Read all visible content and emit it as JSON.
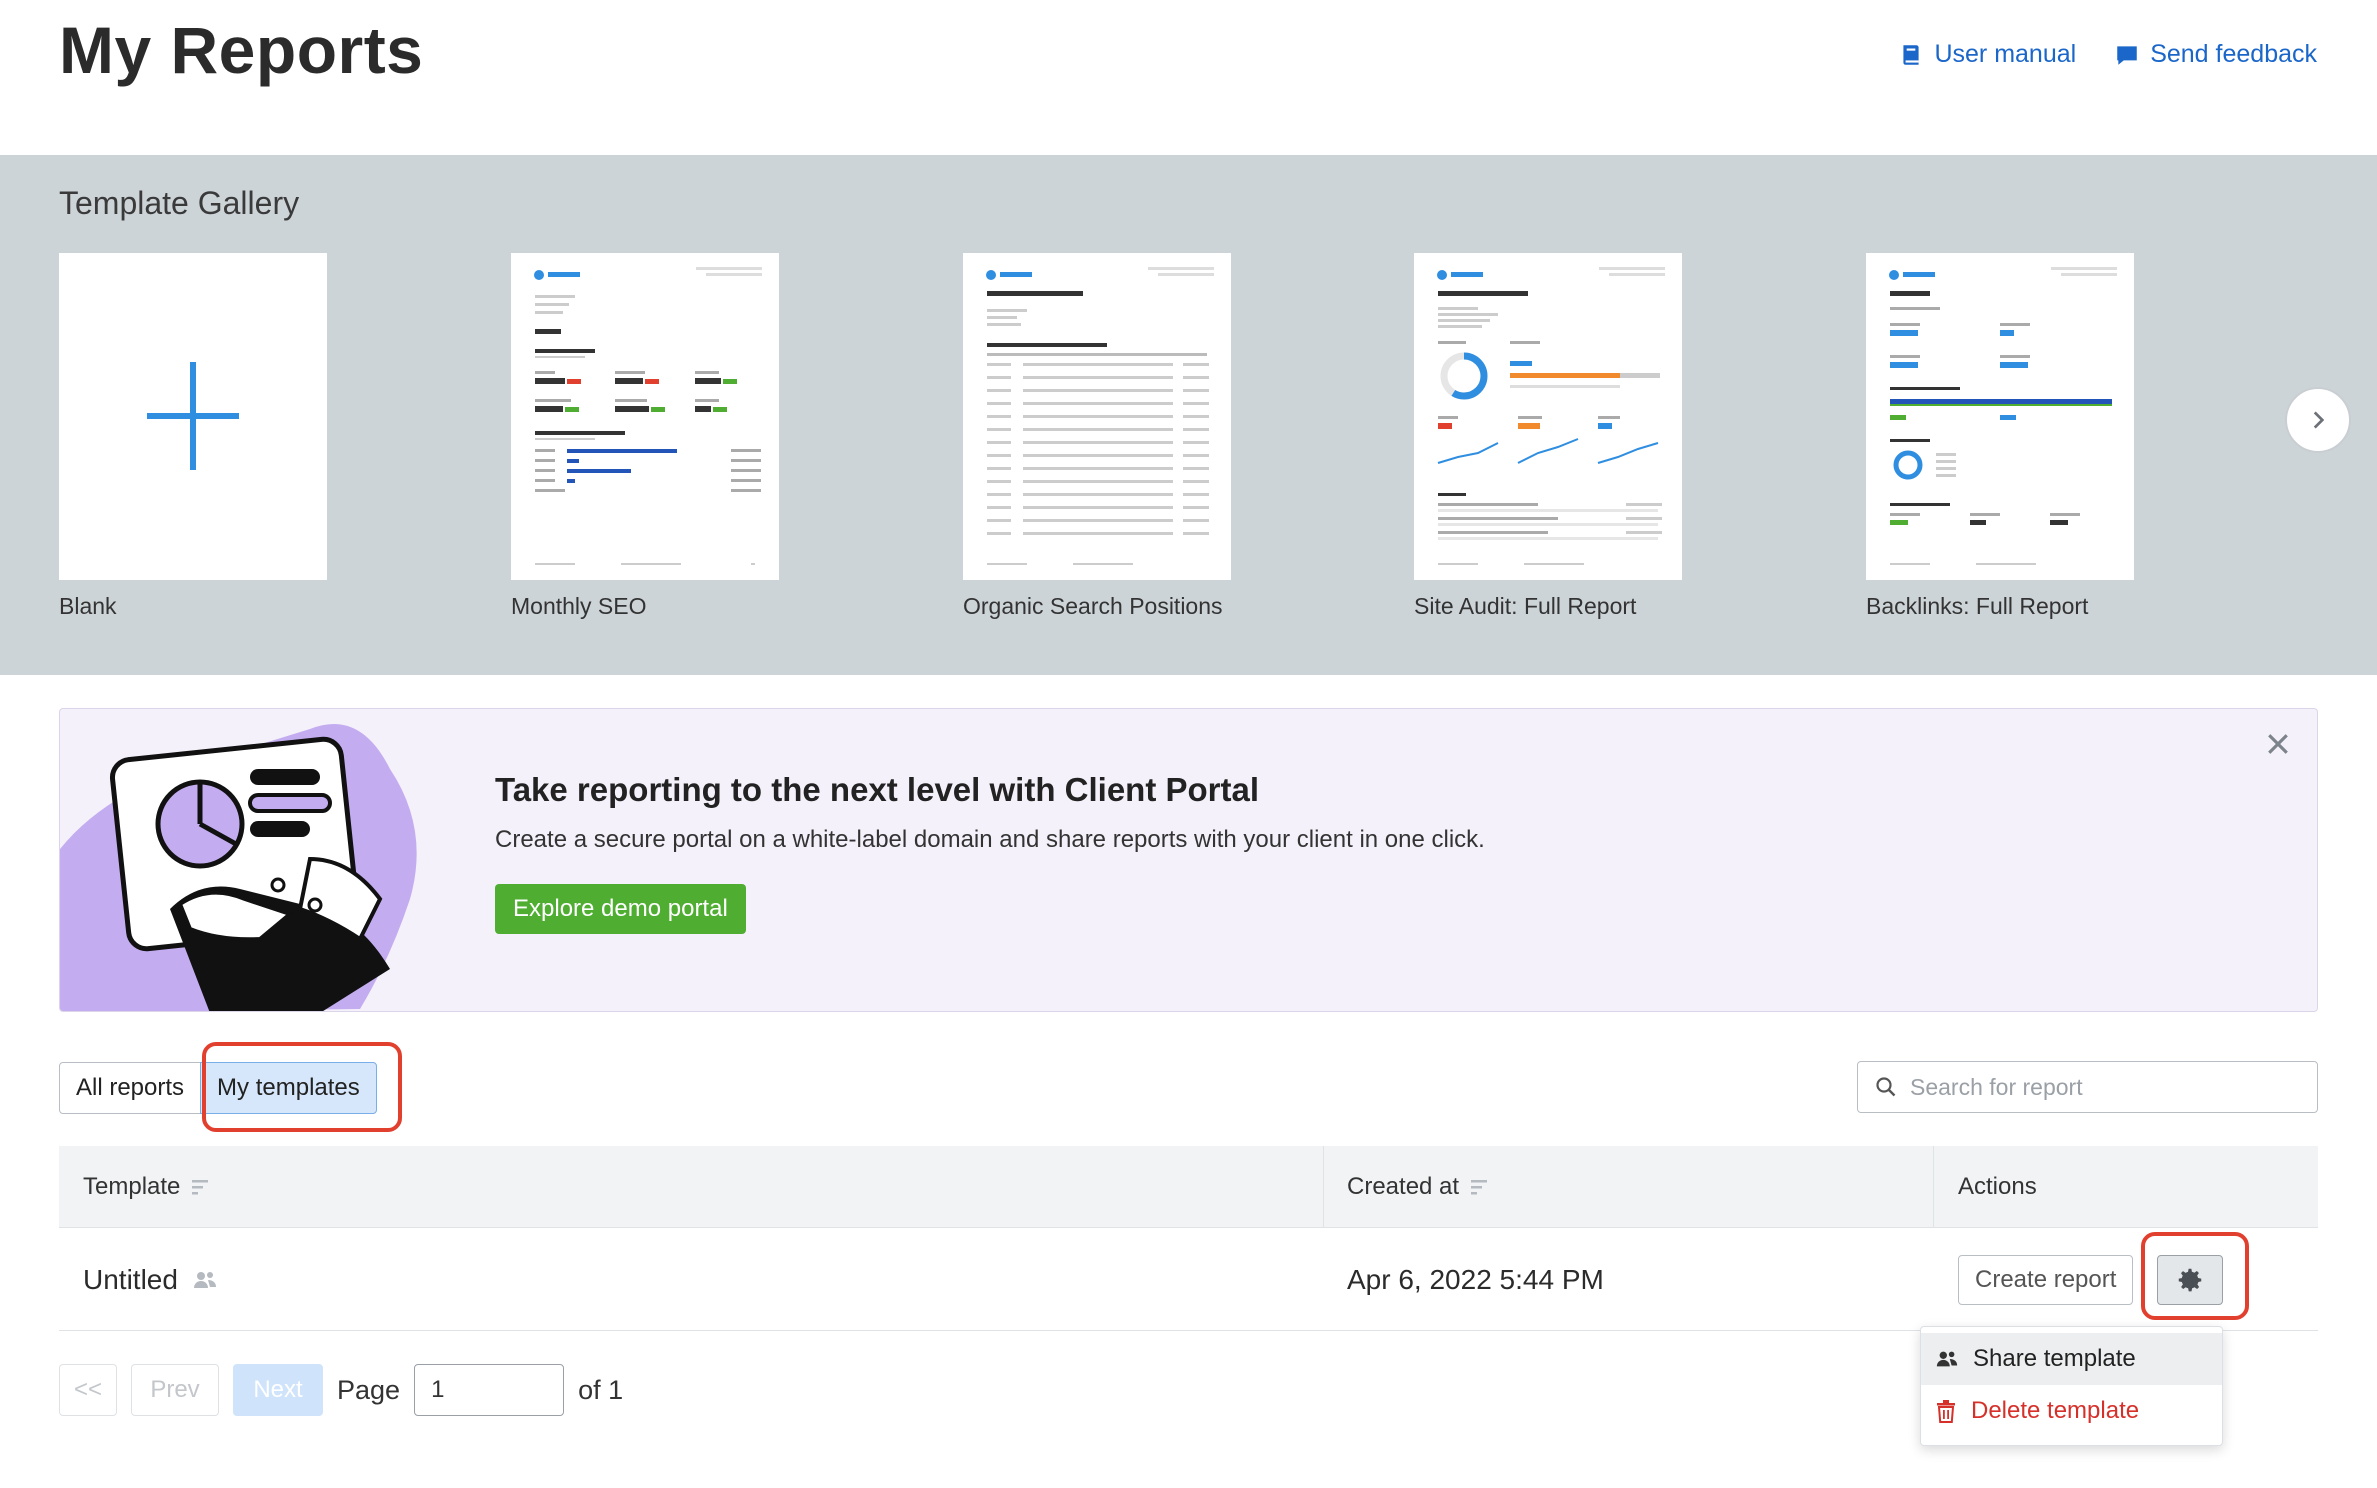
{
  "header": {
    "title": "My Reports",
    "user_manual": "User manual",
    "send_feedback": "Send feedback"
  },
  "gallery": {
    "title": "Template Gallery",
    "items": [
      {
        "label": "Blank"
      },
      {
        "label": "Monthly SEO"
      },
      {
        "label": "Organic Search Positions"
      },
      {
        "label": "Site Audit: Full Report"
      },
      {
        "label": "Backlinks: Full Report"
      }
    ]
  },
  "banner": {
    "title": "Take reporting to the next level with Client Portal",
    "description": "Create a secure portal on a white-label domain and share reports with your client in one click.",
    "button": "Explore demo portal"
  },
  "tabs": {
    "all_reports": "All reports",
    "my_templates": "My templates"
  },
  "search": {
    "placeholder": "Search for report"
  },
  "table": {
    "columns": {
      "template": "Template",
      "created_at": "Created at",
      "actions": "Actions"
    },
    "rows": [
      {
        "name": "Untitled",
        "created_at": "Apr 6, 2022 5:44 PM",
        "create_report": "Create report"
      }
    ]
  },
  "dropdown": {
    "share": "Share template",
    "delete": "Delete template"
  },
  "pagination": {
    "first": "<<",
    "prev": "Prev",
    "next": "Next",
    "page_label": "Page",
    "current": "1",
    "of_label": "of 1"
  },
  "colors": {
    "accent": "#1a66c9",
    "highlight": "#e2402f",
    "success": "#4fae32",
    "danger": "#d6302a"
  }
}
